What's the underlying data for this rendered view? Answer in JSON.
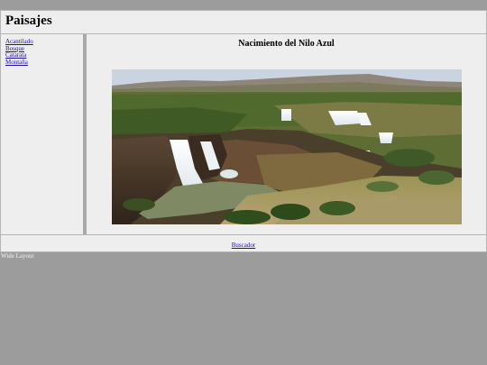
{
  "header": {
    "title": "Paisajes"
  },
  "sidebar": {
    "items": [
      {
        "label": "Acantilado"
      },
      {
        "label": "Bosque"
      },
      {
        "label": "Catarata"
      },
      {
        "label": "Montaña"
      }
    ]
  },
  "main": {
    "title": "Nacimiento del Nilo Azul"
  },
  "footer": {
    "link_label": "Buscador"
  },
  "layout_note": "Wide Layout",
  "colors": {
    "page_background": "#9c9c9c",
    "panel_background": "#eeeeee",
    "link": "#1a0dab"
  }
}
